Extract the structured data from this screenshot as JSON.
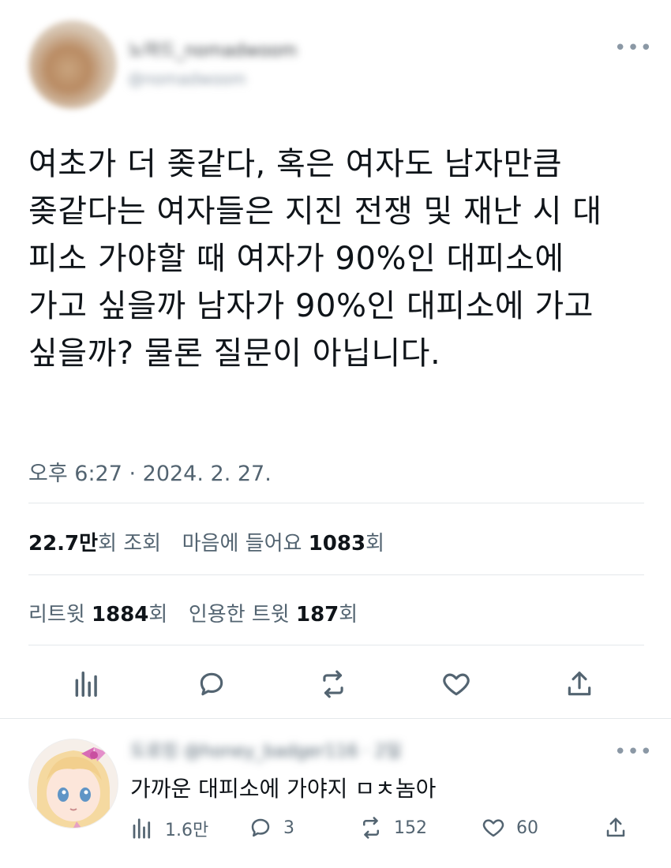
{
  "tweet": {
    "author_name": "노마드_nomadwoom",
    "author_handle": "@nomadwoom",
    "more_icon": "more-dots-icon",
    "text_lines": [
      "여초가 더 좆같다, 혹은 여자도 남자만큼",
      "좆같다는 여자들은 지진 전쟁 및 재난 시 대",
      "피소 가야할 때 여자가 90%인 대피소에",
      "가고 싶을까 남자가 90%인 대피소에 가고",
      "싶을까? 물론 질문이 아닙니다."
    ],
    "timestamp": "오후 6:27 · 2024. 2. 27.",
    "views_count": "22.7만",
    "views_label": "회 조회",
    "likes_label": "마음에 들어요",
    "likes_count": "1083",
    "likes_suffix": "회",
    "retweets_label": "리트윗",
    "retweets_count": "1884",
    "retweets_suffix": "회",
    "quotes_label": "인용한 트윗",
    "quotes_count": "187",
    "quotes_suffix": "회"
  },
  "actions": {
    "icons": [
      "analytics-icon",
      "reply-icon",
      "retweet-icon",
      "like-icon",
      "share-icon"
    ]
  },
  "reply": {
    "author_name": "도로킹 @honey_badger116 · 2일",
    "text": "가까운 대피소에 가야지 ㅁㅊ놈아",
    "views": "1.6만",
    "replies": "3",
    "retweets": "152",
    "likes": "60"
  },
  "colors": {
    "text": "#0f1419",
    "secondary": "#536471",
    "divider": "#e4e8eb"
  }
}
